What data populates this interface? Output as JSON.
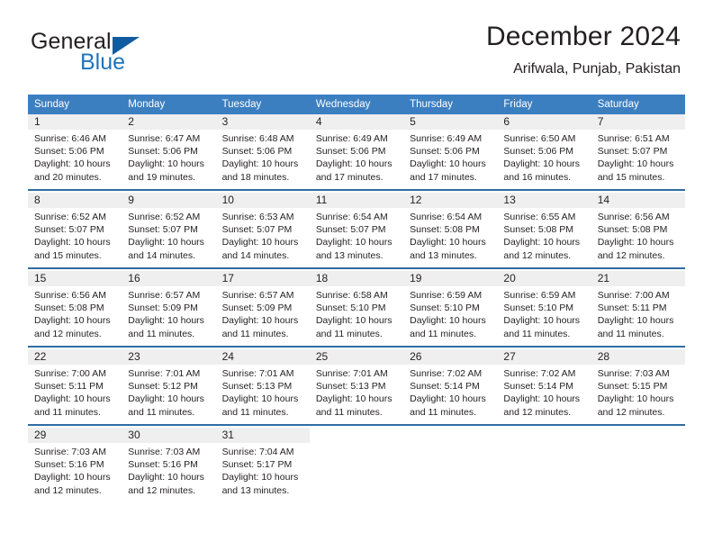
{
  "brand": {
    "name_part1": "General",
    "name_part2": "Blue",
    "accent_color": "#1f74bb",
    "triangle_color": "#115ca0"
  },
  "header": {
    "title": "December 2024",
    "location": "Arifwala, Punjab, Pakistan"
  },
  "theme": {
    "header_row_bg": "#3c7fc1",
    "week_separator": "#2e6da4",
    "daynum_strip_bg": "#efefef",
    "text_color": "#231f20"
  },
  "weekday_headers": [
    "Sunday",
    "Monday",
    "Tuesday",
    "Wednesday",
    "Thursday",
    "Friday",
    "Saturday"
  ],
  "weeks": [
    [
      {
        "day": "1",
        "sunrise": "Sunrise: 6:46 AM",
        "sunset": "Sunset: 5:06 PM",
        "daylight1": "Daylight: 10 hours",
        "daylight2": "and 20 minutes."
      },
      {
        "day": "2",
        "sunrise": "Sunrise: 6:47 AM",
        "sunset": "Sunset: 5:06 PM",
        "daylight1": "Daylight: 10 hours",
        "daylight2": "and 19 minutes."
      },
      {
        "day": "3",
        "sunrise": "Sunrise: 6:48 AM",
        "sunset": "Sunset: 5:06 PM",
        "daylight1": "Daylight: 10 hours",
        "daylight2": "and 18 minutes."
      },
      {
        "day": "4",
        "sunrise": "Sunrise: 6:49 AM",
        "sunset": "Sunset: 5:06 PM",
        "daylight1": "Daylight: 10 hours",
        "daylight2": "and 17 minutes."
      },
      {
        "day": "5",
        "sunrise": "Sunrise: 6:49 AM",
        "sunset": "Sunset: 5:06 PM",
        "daylight1": "Daylight: 10 hours",
        "daylight2": "and 17 minutes."
      },
      {
        "day": "6",
        "sunrise": "Sunrise: 6:50 AM",
        "sunset": "Sunset: 5:06 PM",
        "daylight1": "Daylight: 10 hours",
        "daylight2": "and 16 minutes."
      },
      {
        "day": "7",
        "sunrise": "Sunrise: 6:51 AM",
        "sunset": "Sunset: 5:07 PM",
        "daylight1": "Daylight: 10 hours",
        "daylight2": "and 15 minutes."
      }
    ],
    [
      {
        "day": "8",
        "sunrise": "Sunrise: 6:52 AM",
        "sunset": "Sunset: 5:07 PM",
        "daylight1": "Daylight: 10 hours",
        "daylight2": "and 15 minutes."
      },
      {
        "day": "9",
        "sunrise": "Sunrise: 6:52 AM",
        "sunset": "Sunset: 5:07 PM",
        "daylight1": "Daylight: 10 hours",
        "daylight2": "and 14 minutes."
      },
      {
        "day": "10",
        "sunrise": "Sunrise: 6:53 AM",
        "sunset": "Sunset: 5:07 PM",
        "daylight1": "Daylight: 10 hours",
        "daylight2": "and 14 minutes."
      },
      {
        "day": "11",
        "sunrise": "Sunrise: 6:54 AM",
        "sunset": "Sunset: 5:07 PM",
        "daylight1": "Daylight: 10 hours",
        "daylight2": "and 13 minutes."
      },
      {
        "day": "12",
        "sunrise": "Sunrise: 6:54 AM",
        "sunset": "Sunset: 5:08 PM",
        "daylight1": "Daylight: 10 hours",
        "daylight2": "and 13 minutes."
      },
      {
        "day": "13",
        "sunrise": "Sunrise: 6:55 AM",
        "sunset": "Sunset: 5:08 PM",
        "daylight1": "Daylight: 10 hours",
        "daylight2": "and 12 minutes."
      },
      {
        "day": "14",
        "sunrise": "Sunrise: 6:56 AM",
        "sunset": "Sunset: 5:08 PM",
        "daylight1": "Daylight: 10 hours",
        "daylight2": "and 12 minutes."
      }
    ],
    [
      {
        "day": "15",
        "sunrise": "Sunrise: 6:56 AM",
        "sunset": "Sunset: 5:08 PM",
        "daylight1": "Daylight: 10 hours",
        "daylight2": "and 12 minutes."
      },
      {
        "day": "16",
        "sunrise": "Sunrise: 6:57 AM",
        "sunset": "Sunset: 5:09 PM",
        "daylight1": "Daylight: 10 hours",
        "daylight2": "and 11 minutes."
      },
      {
        "day": "17",
        "sunrise": "Sunrise: 6:57 AM",
        "sunset": "Sunset: 5:09 PM",
        "daylight1": "Daylight: 10 hours",
        "daylight2": "and 11 minutes."
      },
      {
        "day": "18",
        "sunrise": "Sunrise: 6:58 AM",
        "sunset": "Sunset: 5:10 PM",
        "daylight1": "Daylight: 10 hours",
        "daylight2": "and 11 minutes."
      },
      {
        "day": "19",
        "sunrise": "Sunrise: 6:59 AM",
        "sunset": "Sunset: 5:10 PM",
        "daylight1": "Daylight: 10 hours",
        "daylight2": "and 11 minutes."
      },
      {
        "day": "20",
        "sunrise": "Sunrise: 6:59 AM",
        "sunset": "Sunset: 5:10 PM",
        "daylight1": "Daylight: 10 hours",
        "daylight2": "and 11 minutes."
      },
      {
        "day": "21",
        "sunrise": "Sunrise: 7:00 AM",
        "sunset": "Sunset: 5:11 PM",
        "daylight1": "Daylight: 10 hours",
        "daylight2": "and 11 minutes."
      }
    ],
    [
      {
        "day": "22",
        "sunrise": "Sunrise: 7:00 AM",
        "sunset": "Sunset: 5:11 PM",
        "daylight1": "Daylight: 10 hours",
        "daylight2": "and 11 minutes."
      },
      {
        "day": "23",
        "sunrise": "Sunrise: 7:01 AM",
        "sunset": "Sunset: 5:12 PM",
        "daylight1": "Daylight: 10 hours",
        "daylight2": "and 11 minutes."
      },
      {
        "day": "24",
        "sunrise": "Sunrise: 7:01 AM",
        "sunset": "Sunset: 5:13 PM",
        "daylight1": "Daylight: 10 hours",
        "daylight2": "and 11 minutes."
      },
      {
        "day": "25",
        "sunrise": "Sunrise: 7:01 AM",
        "sunset": "Sunset: 5:13 PM",
        "daylight1": "Daylight: 10 hours",
        "daylight2": "and 11 minutes."
      },
      {
        "day": "26",
        "sunrise": "Sunrise: 7:02 AM",
        "sunset": "Sunset: 5:14 PM",
        "daylight1": "Daylight: 10 hours",
        "daylight2": "and 11 minutes."
      },
      {
        "day": "27",
        "sunrise": "Sunrise: 7:02 AM",
        "sunset": "Sunset: 5:14 PM",
        "daylight1": "Daylight: 10 hours",
        "daylight2": "and 12 minutes."
      },
      {
        "day": "28",
        "sunrise": "Sunrise: 7:03 AM",
        "sunset": "Sunset: 5:15 PM",
        "daylight1": "Daylight: 10 hours",
        "daylight2": "and 12 minutes."
      }
    ],
    [
      {
        "day": "29",
        "sunrise": "Sunrise: 7:03 AM",
        "sunset": "Sunset: 5:16 PM",
        "daylight1": "Daylight: 10 hours",
        "daylight2": "and 12 minutes."
      },
      {
        "day": "30",
        "sunrise": "Sunrise: 7:03 AM",
        "sunset": "Sunset: 5:16 PM",
        "daylight1": "Daylight: 10 hours",
        "daylight2": "and 12 minutes."
      },
      {
        "day": "31",
        "sunrise": "Sunrise: 7:04 AM",
        "sunset": "Sunset: 5:17 PM",
        "daylight1": "Daylight: 10 hours",
        "daylight2": "and 13 minutes."
      },
      {
        "day": "",
        "sunrise": "",
        "sunset": "",
        "daylight1": "",
        "daylight2": ""
      },
      {
        "day": "",
        "sunrise": "",
        "sunset": "",
        "daylight1": "",
        "daylight2": ""
      },
      {
        "day": "",
        "sunrise": "",
        "sunset": "",
        "daylight1": "",
        "daylight2": ""
      },
      {
        "day": "",
        "sunrise": "",
        "sunset": "",
        "daylight1": "",
        "daylight2": ""
      }
    ]
  ]
}
